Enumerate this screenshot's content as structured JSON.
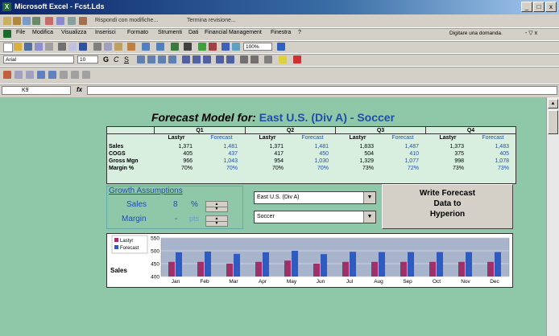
{
  "window": {
    "title": "Microsoft Excel - Fcst.Lds",
    "buttons": [
      "_",
      "□",
      "x"
    ]
  },
  "toolbar_top": {
    "review_text": "Rispondi con modifiche...",
    "end_review": "Termina revisione..."
  },
  "menu": {
    "items": [
      "File",
      "Modifica",
      "Visualizza",
      "Inserisci",
      "Formato",
      "Strumenti",
      "Dati",
      "Financial Management",
      "Finestra",
      "?"
    ],
    "help_placeholder": "Digitare una domanda."
  },
  "standard_toolbar": {
    "zoom": "100%"
  },
  "format_toolbar": {
    "font": "Arial",
    "size": "10"
  },
  "formula_bar": {
    "name_box": "K9",
    "fx": "fx",
    "content": ""
  },
  "sheet": {
    "heading_label": "Forecast Model for:",
    "heading_value": "East U.S. (Div A) - Soccer",
    "quarters": [
      "Q1",
      "Q2",
      "Q3",
      "Q4"
    ],
    "col_lastyr": "Lastyr",
    "col_forecast": "Forecast",
    "rows": [
      {
        "label": "Sales",
        "values": [
          "1,371",
          "1,481",
          "1,371",
          "1,481",
          "1,833",
          "1,487",
          "1,373",
          "1,483"
        ]
      },
      {
        "label": "COGS",
        "values": [
          "405",
          "437",
          "417",
          "450",
          "504",
          "410",
          "375",
          "405"
        ]
      },
      {
        "label": "Gross Mgn",
        "values": [
          "966",
          "1,043",
          "954",
          "1,030",
          "1,329",
          "1,077",
          "998",
          "1,078"
        ]
      },
      {
        "label": "Margin %",
        "values": [
          "70%",
          "70%",
          "70%",
          "70%",
          "73%",
          "72%",
          "73%",
          "73%"
        ]
      }
    ],
    "growth": {
      "title": "Growth Assumptions",
      "sales_label": "Sales",
      "sales_value": "8",
      "sales_unit": "%",
      "margin_label": "Margin",
      "margin_value": "-",
      "margin_unit": "pts"
    },
    "dropdown_division": "East U.S. (Div A)",
    "dropdown_product": "Soccer",
    "write_button": {
      "line1": "Write Forecast",
      "line2": "Data to",
      "line3": "Hyperion"
    }
  },
  "chart_data": {
    "type": "bar",
    "ylabel": "Sales",
    "categories": [
      "Jan",
      "Feb",
      "Mar",
      "Apr",
      "May",
      "Jun",
      "Jul",
      "Aug",
      "Sep",
      "Oct",
      "Nov",
      "Dec"
    ],
    "ylim": [
      400,
      550
    ],
    "yticks": [
      "550",
      "500",
      "450",
      "400"
    ],
    "legend_position": "top-left",
    "series": [
      {
        "name": "Lastyr",
        "color": "#a0306a",
        "values": [
          457,
          457,
          450,
          457,
          462,
          450,
          457,
          457,
          457,
          457,
          457,
          457
        ]
      },
      {
        "name": "Forecast",
        "color": "#2f5ac0",
        "values": [
          494,
          497,
          488,
          494,
          500,
          487,
          496,
          495,
          495,
          495,
          495,
          495
        ]
      }
    ]
  }
}
